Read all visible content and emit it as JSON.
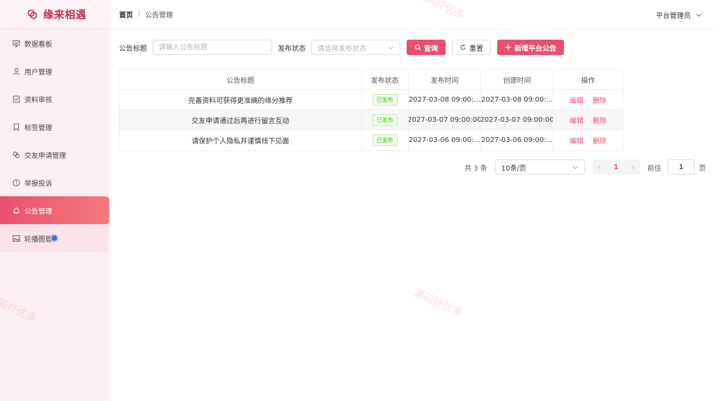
{
  "app": {
    "title": "缘来相遇"
  },
  "sidebar": {
    "items": [
      {
        "label": "数据看板",
        "icon": "dashboard-icon"
      },
      {
        "label": "用户管理",
        "icon": "user-icon"
      },
      {
        "label": "资料审核",
        "icon": "document-check-icon"
      },
      {
        "label": "标签管理",
        "icon": "bookmark-icon"
      },
      {
        "label": "交友申请管理",
        "icon": "link-icon"
      },
      {
        "label": "举报投诉",
        "icon": "warning-icon"
      },
      {
        "label": "公告管理",
        "icon": "bell-icon"
      },
      {
        "label": "轮播图管",
        "icon": "image-icon"
      }
    ],
    "active_index": 6
  },
  "header": {
    "breadcrumb_home": "首页",
    "breadcrumb_sep": "/",
    "breadcrumb_current": "公告管理",
    "user": "平台管理员"
  },
  "filter": {
    "title_label": "公告标题",
    "title_placeholder": "请输入公告标题",
    "status_label": "发布状态",
    "status_placeholder": "请选择发布状态",
    "search_label": "查询",
    "reset_label": "重置",
    "add_label": "新增平台公告"
  },
  "table": {
    "columns": [
      "公告标题",
      "发布状态",
      "发布时间",
      "创建时间",
      "操作"
    ],
    "rows": [
      {
        "title": "完善资料可获得更准确的缘分推荐",
        "status": "已发布",
        "publish_time": "2027-03-08 09:00:...",
        "create_time": "2027-03-08 09:00:..."
      },
      {
        "title": "交友申请通过后再进行留言互动",
        "status": "已发布",
        "publish_time": "2027-03-07 09:00:00",
        "create_time": "2027-03-07 09:00:00"
      },
      {
        "title": "请保护个人隐私并谨慎线下见面",
        "status": "已发布",
        "publish_time": "2027-03-06 09:00:...",
        "create_time": "2027-03-06 09:00:..."
      }
    ],
    "edit_label": "编辑",
    "delete_label": "删除"
  },
  "pagination": {
    "total_text": "共 3 条",
    "page_size": "10条/页",
    "current_page": "1",
    "goto_label": "前往",
    "goto_value": "1",
    "page_unit": "页"
  },
  "watermark": {
    "text": "源码好优多"
  },
  "colors": {
    "accent": "#e9506d",
    "sidebar_bg": "#fdf0f2",
    "tag_green": "#52c41a"
  }
}
